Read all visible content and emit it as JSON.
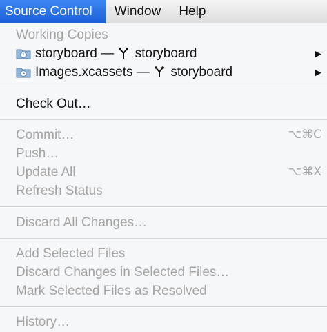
{
  "menubar": {
    "items": [
      {
        "label": "Source Control"
      },
      {
        "label": "Window"
      },
      {
        "label": "Help"
      }
    ]
  },
  "menu": {
    "section_header": "Working Copies",
    "working_copies": [
      {
        "repo": "storyboard",
        "separator": "—",
        "branch": "storyboard"
      },
      {
        "repo": "Images.xcassets",
        "separator": "—",
        "branch": "storyboard"
      }
    ],
    "check_out": "Check Out…",
    "commit": {
      "label": "Commit…",
      "shortcut": "⌥⌘C"
    },
    "push": "Push…",
    "update_all": {
      "label": "Update All",
      "shortcut": "⌥⌘X"
    },
    "refresh_status": "Refresh Status",
    "discard_all": "Discard All Changes…",
    "add_selected": "Add Selected Files",
    "discard_selected": "Discard Changes in Selected Files…",
    "mark_resolved": "Mark Selected Files as Resolved",
    "history": "History…"
  },
  "icons": {
    "working_copy": "folder-clock-icon",
    "branch": "branch-icon",
    "submenu": "triangle-right-icon"
  },
  "colors": {
    "accent": "#2a6fe6",
    "disabled_text": "#a4a4a4"
  }
}
